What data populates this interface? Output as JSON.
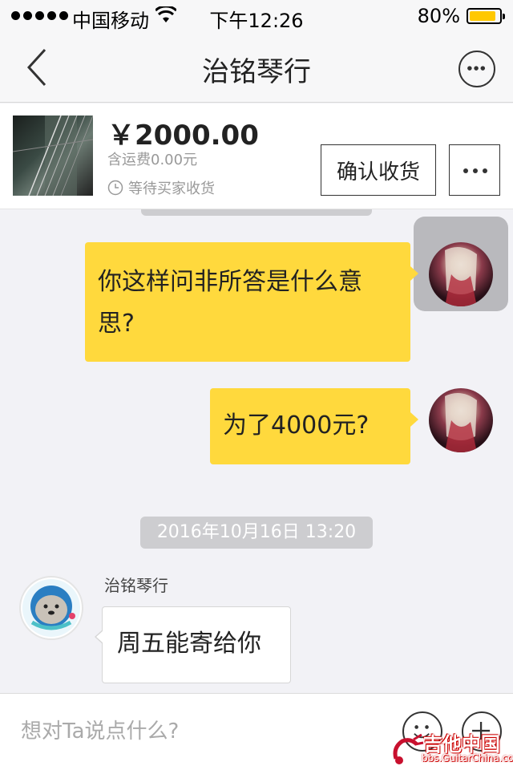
{
  "status_bar": {
    "carrier": "中国移动",
    "time": "下午12:26",
    "battery": "80%",
    "battery_level": 0.8
  },
  "nav": {
    "title": "治铭琴行",
    "back_icon": "chevron-left-icon",
    "more_icon": "more-circle-icon"
  },
  "order": {
    "price": "￥2000.00",
    "shipping": "含运费0.00元",
    "status": "等待买家收货",
    "confirm_label": "确认收货",
    "thumb_icon": "guitar-strings-photo"
  },
  "messages": [
    {
      "sender": "me",
      "text": "你这样问非所答是什么意思?"
    },
    {
      "sender": "me",
      "text": "为了4000元?"
    },
    {
      "type": "timestamp",
      "text": "2016年10月16日 13:20"
    },
    {
      "sender": "shop",
      "name": "治铭琴行",
      "text": "周五能寄给你"
    }
  ],
  "input": {
    "placeholder": "想对Ta说点什么?",
    "emoji_icon": "smiley-icon",
    "add_icon": "plus-circle-icon"
  },
  "watermark": {
    "title": "吉他中国",
    "url": "bbs.GuitarChina.com"
  },
  "colors": {
    "my_bubble": "#ffd93d",
    "battery": "#ffc800",
    "background": "#f2f2f6"
  }
}
